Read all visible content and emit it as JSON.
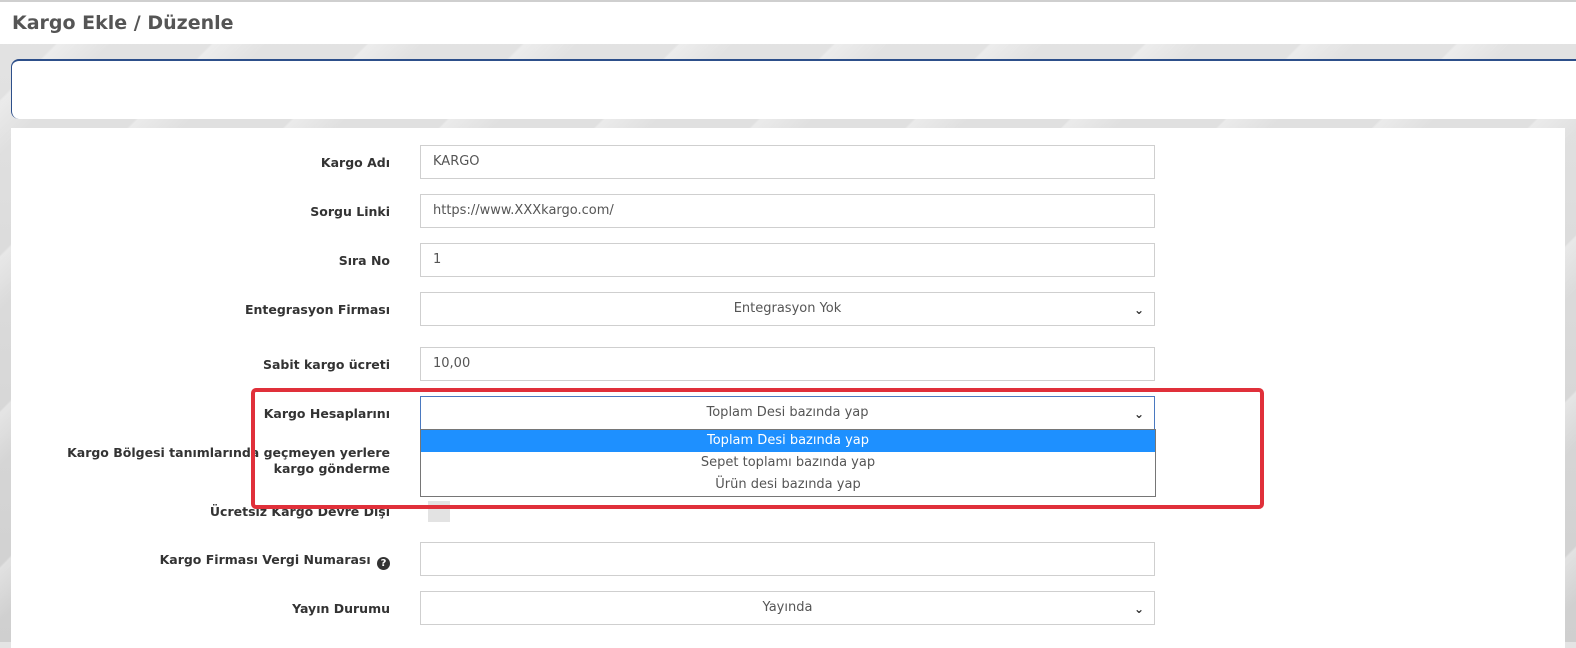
{
  "header": {
    "title": "Kargo Ekle / Düzenle"
  },
  "form": {
    "kargo_adi": {
      "label": "Kargo Adı",
      "value": "KARGO"
    },
    "sorgu_linki": {
      "label": "Sorgu Linki",
      "value": "https://www.XXXkargo.com/"
    },
    "sira_no": {
      "label": "Sıra No",
      "value": "1"
    },
    "entegrasyon": {
      "label": "Entegrasyon Firması",
      "value": "Entegrasyon Yok"
    },
    "sabit_ucret": {
      "label": "Sabit kargo ücreti",
      "value": "10,00"
    },
    "hesaplari": {
      "label": "Kargo Hesaplarını",
      "value": "Toplam Desi bazında yap",
      "options": [
        "Toplam Desi bazında yap",
        "Sepet toplamı bazında yap",
        "Ürün desi bazında yap"
      ]
    },
    "bolge": {
      "label": "Kargo Bölgesi tanımlarında geçmeyen yerlere kargo gönderme"
    },
    "ucretsiz": {
      "label": "Ücretsiz Kargo Devre Dışı"
    },
    "vergi_no": {
      "label": "Kargo Firması Vergi Numarası",
      "value": ""
    },
    "yayin": {
      "label": "Yayın Durumu",
      "value": "Yayında"
    }
  },
  "icons": {
    "chevron": "chevron-down-icon",
    "info": "question-circle-icon"
  },
  "colors": {
    "highlight": "#e0303a",
    "selected_option": "#1e90ff",
    "panel_border": "#2d4f8a"
  }
}
